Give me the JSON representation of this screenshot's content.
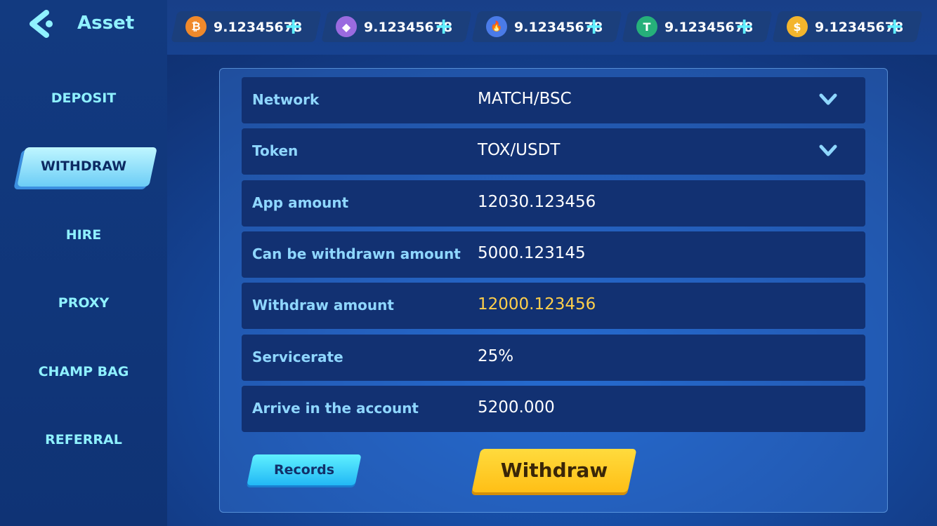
{
  "header": {
    "title": "Asset"
  },
  "balances": [
    {
      "icon": "bitcoin-icon",
      "symbol": "₿",
      "color": "#f0892b",
      "amount": "9.12345678"
    },
    {
      "icon": "ethereum-icon",
      "symbol": "◆",
      "color": "#9a6be0",
      "amount": "9.12345678"
    },
    {
      "icon": "flame-token-icon",
      "symbol": "🔥",
      "color": "#4a7be8",
      "amount": "9.12345678"
    },
    {
      "icon": "tether-icon",
      "symbol": "T",
      "color": "#26b07a",
      "amount": "9.12345678"
    },
    {
      "icon": "dollar-coin-icon",
      "symbol": "$",
      "color": "#f3b52d",
      "amount": "9.12345678"
    }
  ],
  "sidebar": {
    "items": [
      {
        "label": "DEPOSIT"
      },
      {
        "label": "WITHDRAW"
      },
      {
        "label": "HIRE"
      },
      {
        "label": "PROXY"
      },
      {
        "label": "CHAMP BAG"
      },
      {
        "label": "REFERRAL"
      }
    ],
    "active": "WITHDRAW"
  },
  "form": {
    "rows": [
      {
        "label": "Network",
        "value": "MATCH/BSC"
      },
      {
        "label": "Token",
        "value": "TOX/USDT"
      },
      {
        "label": "App amount",
        "value": "12030.123456"
      },
      {
        "label": "Can be withdrawn amount",
        "value": "5000.123145"
      },
      {
        "label": "Withdraw amount",
        "value": "12000.123456"
      },
      {
        "label": "Servicerate",
        "value": "25%"
      },
      {
        "label": "Arrive in the account",
        "value": "5200.000"
      }
    ]
  },
  "actions": {
    "records_label": "Records",
    "withdraw_label": "Withdraw"
  },
  "colors": {
    "accent": "#8ff1ff",
    "highlight_value": "#ffcf4a",
    "withdraw_button": "#ffc61f"
  }
}
